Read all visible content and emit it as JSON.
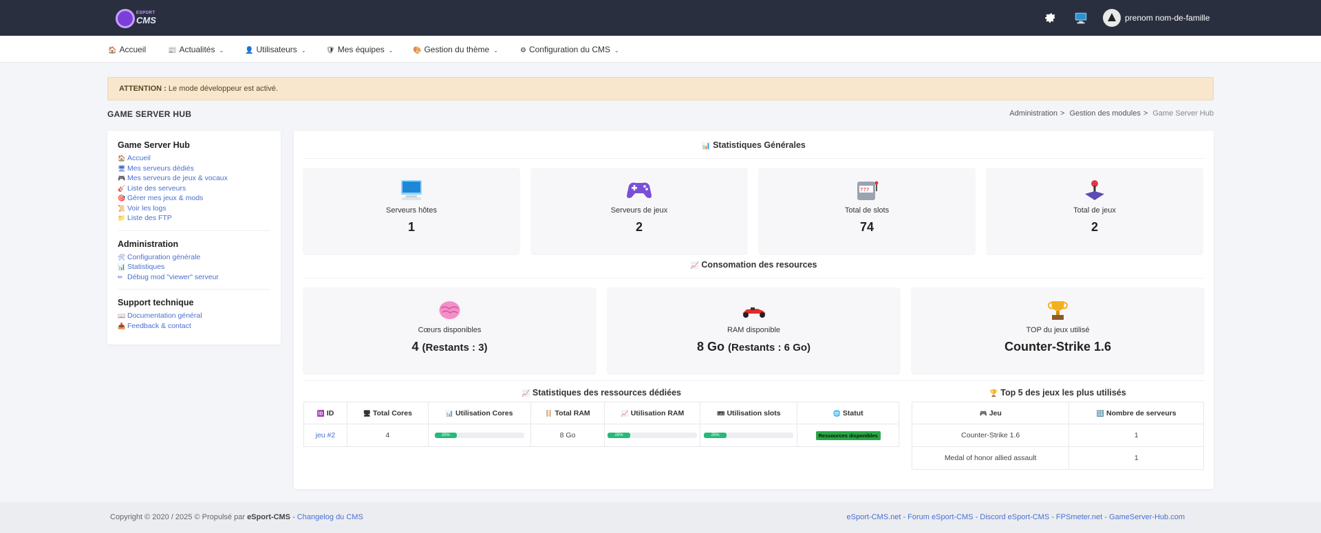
{
  "header": {
    "logo_small": "ESPORT",
    "logo_text": "CMS",
    "username": "prenom nom-de-famille"
  },
  "nav": {
    "items": [
      {
        "label": "Accueil",
        "icon": "house-icon"
      },
      {
        "label": "Actualités",
        "icon": "news-icon"
      },
      {
        "label": "Utilisateurs",
        "icon": "user-icon"
      },
      {
        "label": "Mes équipes",
        "icon": "shield-icon"
      },
      {
        "label": "Gestion du thème",
        "icon": "palette-icon"
      },
      {
        "label": "Configuration du CMS",
        "icon": "gear-icon"
      }
    ]
  },
  "alert": {
    "strong": "ATTENTION :",
    "text": " Le mode développeur est activé."
  },
  "page": {
    "title": "GAME SERVER HUB",
    "breadcrumb": [
      "Administration",
      "Gestion des modules",
      "Game Server Hub"
    ]
  },
  "sidebar": {
    "sections": [
      {
        "title": "Game Server Hub",
        "links": [
          "Accueil",
          "Mes serveurs dédiés",
          "Mes serveurs de jeux & vocaux",
          "Liste des serveurs",
          "Gérer mes jeux & mods",
          "Voir les logs",
          "Liste des FTP"
        ]
      },
      {
        "title": "Administration",
        "links": [
          "Configuration générale",
          "Statistiques",
          "Débug mod \"viewer\" serveur"
        ]
      },
      {
        "title": "Support technique",
        "links": [
          "Documentation général",
          "Feedback & contact"
        ]
      }
    ]
  },
  "stats": {
    "title": "Statistiques Générales",
    "cards": [
      {
        "label": "Serveurs hôtes",
        "value": "1",
        "icon": "monitor-icon"
      },
      {
        "label": "Serveurs de jeux",
        "value": "2",
        "icon": "gamepad-icon"
      },
      {
        "label": "Total de slots",
        "value": "74",
        "icon": "slot-machine-icon"
      },
      {
        "label": "Total de jeux",
        "value": "2",
        "icon": "joystick-icon"
      }
    ]
  },
  "resources": {
    "title": "Consomation des resources",
    "cards": [
      {
        "label": "Cœurs disponibles",
        "value": "4",
        "extra": "(Restants : 3)",
        "icon": "brain-icon"
      },
      {
        "label": "RAM disponible",
        "value": "8 Go",
        "extra": "(Restants : 6 Go)",
        "icon": "racecar-icon"
      },
      {
        "label": "TOP du jeux utilisé",
        "value": "Counter-Strike 1.6",
        "extra": "",
        "icon": "trophy-icon"
      }
    ]
  },
  "dedicated": {
    "title": "Statistiques des ressources dédiées",
    "headers": [
      "ID",
      "Total Cores",
      "Utilisation Cores",
      "Total RAM",
      "Utilisation RAM",
      "Utilisation slots",
      "Statut"
    ],
    "rows": [
      {
        "id": "jeu #2",
        "total_cores": "4",
        "cores_pct": 25,
        "cores_label": "25%",
        "total_ram": "8 Go",
        "ram_pct": 25,
        "ram_label": "25%",
        "slots_pct": 25,
        "slots_label": "25%",
        "status": "Ressources disponibles"
      }
    ]
  },
  "top5": {
    "title": "Top 5 des jeux les plus utilisés",
    "headers": [
      "Jeu",
      "Nombre de serveurs"
    ],
    "rows": [
      {
        "game": "Counter-Strike 1.6",
        "count": "1"
      },
      {
        "game": "Medal of honor allied assault",
        "count": "1"
      }
    ]
  },
  "footer": {
    "copyright": "Copyright © 2020 / 2025 © Propulsé par ",
    "brand": "eSport-CMS",
    "dash": " - ",
    "changelog": "Changelog du CMS",
    "links": "eSport-CMS.net - Forum eSport-CMS - Discord eSport-CMS - FPSmeter.net - GameServer-Hub.com"
  },
  "colors": {
    "topbar": "#2a2f40",
    "accent": "#4a6fd0",
    "progress": "#27b97a",
    "badge": "#28a745",
    "alert_bg": "#f8e6cd"
  }
}
